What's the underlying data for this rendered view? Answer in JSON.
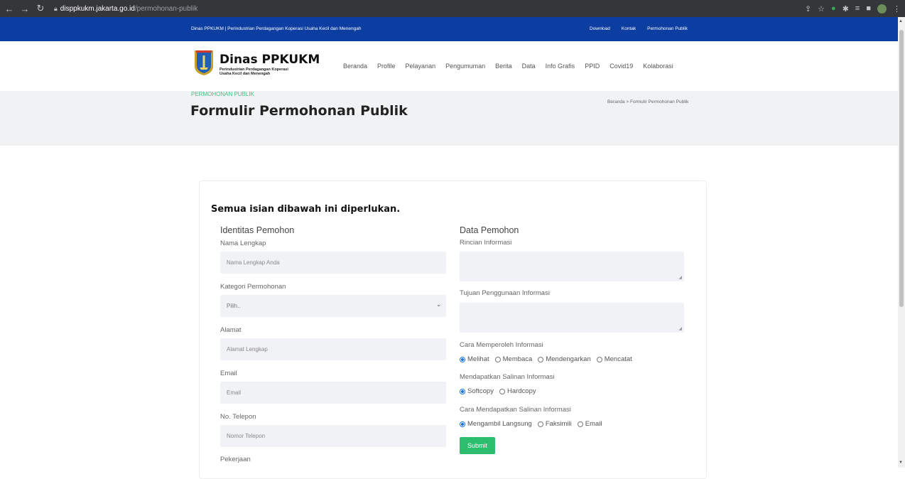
{
  "browser": {
    "url_host": "disppkukm.jakarta.go.id",
    "url_path": "/permohonan-publik"
  },
  "topbar": {
    "tagline": "Dinas PPKUKM | Perindustrian Perdagangan Koperasi Usaha Kecil dan Menengah",
    "links": [
      "Download",
      "Kontak",
      "Permohonan Publik"
    ]
  },
  "header": {
    "logo_title": "Dinas PPKUKM",
    "logo_sub1": "Perindustrian Perdagangan Koperasi",
    "logo_sub2": "Usaha Kecil dan Menengah",
    "nav": [
      "Beranda",
      "Profile",
      "Pelayanan",
      "Pengumuman",
      "Berita",
      "Data",
      "Info Grafis",
      "PPID",
      "Covid19",
      "Kolaborasi"
    ]
  },
  "hero": {
    "eyebrow": "PERMOHONAN PUBLIK",
    "title": "Formulir Permohonan Publik",
    "breadcrumb": "Beranda  >  Formulir Permohonan Publik"
  },
  "form": {
    "heading": "Semua isian dibawah ini diperlukan.",
    "left": {
      "title": "Identitas Pemohon",
      "nama_label": "Nama Lengkap",
      "nama_placeholder": "Nama Lengkap Anda",
      "kategori_label": "Kategori Permohonan",
      "kategori_value": "Pilih..",
      "alamat_label": "Alamat",
      "alamat_placeholder": "Alamat Lengkap",
      "email_label": "Email",
      "email_placeholder": "Email",
      "telepon_label": "No. Telepon",
      "telepon_placeholder": "Nomor Telepon",
      "pekerjaan_label": "Pekerjaan"
    },
    "right": {
      "title": "Data Pemohon",
      "rincian_label": "Rincian Informasi",
      "tujuan_label": "Tujuan Penggunaan Informasi",
      "cara_label": "Cara Memperoleh Informasi",
      "cara_options": [
        "Melihat",
        "Membaca",
        "Mendengarkan",
        "Mencatat"
      ],
      "salinan_label": "Mendapatkan Salinan Informasi",
      "salinan_options": [
        "Softcopy",
        "Hardcopy"
      ],
      "cara_salinan_label": "Cara Mendapatkan Salinan Informasi",
      "cara_salinan_options": [
        "Mengambil Langsung",
        "Faksimili",
        "Email"
      ]
    },
    "submit_label": "Submit"
  }
}
